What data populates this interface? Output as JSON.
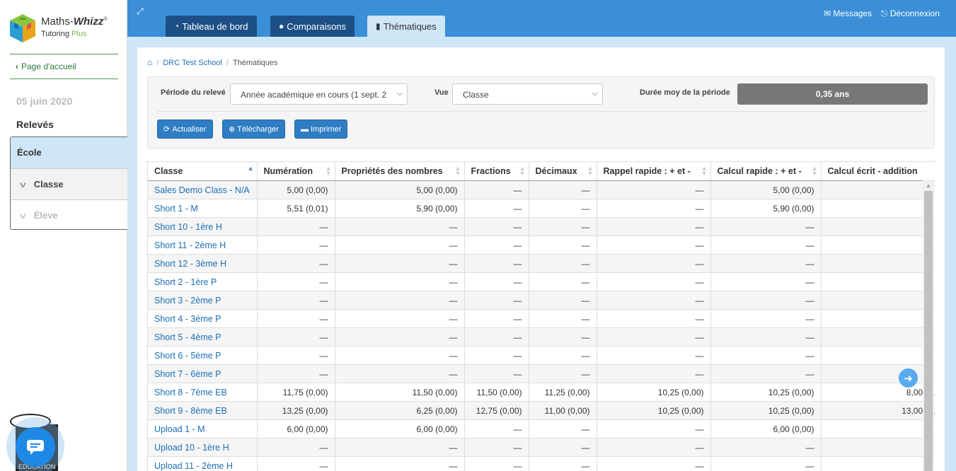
{
  "logo": {
    "brand_plain": "Maths-",
    "brand_bold": "Whizz",
    "reg": "®",
    "sub_plain": "Tutoring ",
    "sub_accent": "Plus"
  },
  "sidebar": {
    "home_link": "Page d'accueil",
    "date": "05 juin 2020",
    "section_title": "Relevés",
    "nav": {
      "ecole": "École",
      "classe": "Classe",
      "eleve": "Élève"
    },
    "edu_text": "EDUCATION"
  },
  "tabs": [
    {
      "label": "Tableau de bord",
      "icon": "dashboard-icon"
    },
    {
      "label": "Comparaisons",
      "icon": "user-icon"
    },
    {
      "label": "Thématiques",
      "icon": "book-icon"
    }
  ],
  "top_links": {
    "messages": "Messages",
    "logout": "Déconnexion"
  },
  "breadcrumb": {
    "school": "DRC Test School",
    "current": "Thématiques"
  },
  "filters": {
    "period_label": "Période du relevé",
    "period_value": "Année académique en cours (1 sept. 2",
    "view_label": "Vue",
    "view_value": "Classe",
    "duration_label": "Durée moy de la période",
    "duration_value": "0,35 ans"
  },
  "buttons": {
    "refresh": "Actualiser",
    "download": "Télécharger",
    "print": "Imprimer"
  },
  "table": {
    "columns": [
      "Classe",
      "Numération",
      "Propriétés des nombres",
      "Fractions",
      "Décimaux",
      "Rappel rapide : + et -",
      "Calcul rapide : + et -",
      "Calcul écrit - addition"
    ],
    "rows": [
      [
        "Sales Demo Class - N/A",
        "5,00 (0,00)",
        "5,00 (0,00)",
        "—",
        "—",
        "—",
        "5,00 (0,00)",
        ""
      ],
      [
        "Short 1 - M",
        "5,51 (0,01)",
        "5,90 (0,00)",
        "—",
        "—",
        "—",
        "5,90 (0,00)",
        ""
      ],
      [
        "Short 10 - 1ère H",
        "—",
        "—",
        "—",
        "—",
        "—",
        "—",
        ""
      ],
      [
        "Short 11 - 2ème H",
        "—",
        "—",
        "—",
        "—",
        "—",
        "—",
        ""
      ],
      [
        "Short 12 - 3ème H",
        "—",
        "—",
        "—",
        "—",
        "—",
        "—",
        ""
      ],
      [
        "Short 2 - 1ère P",
        "—",
        "—",
        "—",
        "—",
        "—",
        "—",
        ""
      ],
      [
        "Short 3 - 2ème P",
        "—",
        "—",
        "—",
        "—",
        "—",
        "—",
        ""
      ],
      [
        "Short 4 - 3ème P",
        "—",
        "—",
        "—",
        "—",
        "—",
        "—",
        ""
      ],
      [
        "Short 5 - 4ème P",
        "—",
        "—",
        "—",
        "—",
        "—",
        "—",
        ""
      ],
      [
        "Short 6 - 5ème P",
        "—",
        "—",
        "—",
        "—",
        "—",
        "—",
        ""
      ],
      [
        "Short 7 - 6ème P",
        "—",
        "—",
        "—",
        "—",
        "—",
        "—",
        ""
      ],
      [
        "Short 8 - 7ème EB",
        "11,75 (0,00)",
        "11,50 (0,00)",
        "11,50 (0,00)",
        "11,25 (0,00)",
        "10,25 (0,00)",
        "10,25 (0,00)",
        "8,00 (0,("
      ],
      [
        "Short 9 - 8ème EB",
        "13,25 (0,00)",
        "6,25 (0,00)",
        "12,75 (0,00)",
        "11,00 (0,00)",
        "10,25 (0,00)",
        "10,25 (0,00)",
        "13,00 (0,("
      ],
      [
        "Upload 1 - M",
        "6,00 (0,00)",
        "6,00 (0,00)",
        "—",
        "—",
        "—",
        "6,00 (0,00)",
        ""
      ],
      [
        "Upload 10 - 1ère H",
        "—",
        "—",
        "—",
        "—",
        "—",
        "—",
        ""
      ],
      [
        "Upload 11 - 2ème H",
        "—",
        "—",
        "—",
        "—",
        "—",
        "—",
        ""
      ]
    ]
  },
  "colors": {
    "topbar": "#3a8fd6",
    "tab_dark": "#1c4f86",
    "accent_light": "#cfe6f7",
    "link": "#1c6fb6",
    "button": "#2f7dc3",
    "brand_green": "#4a9a4a"
  }
}
